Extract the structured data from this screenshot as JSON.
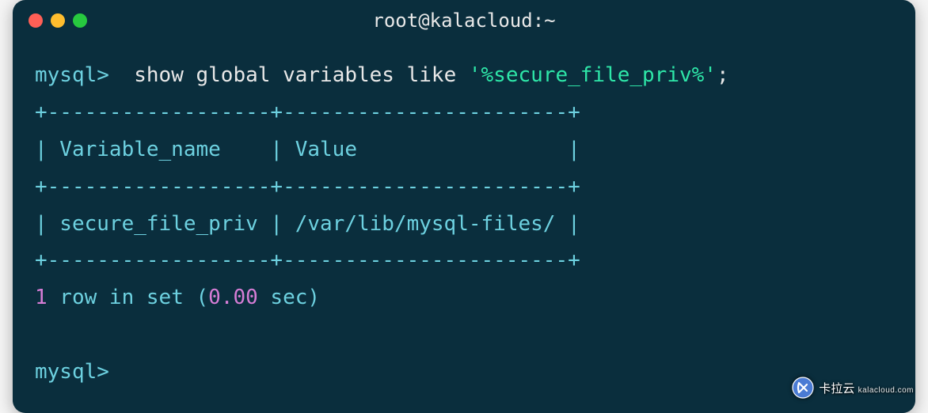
{
  "window": {
    "title": "root@kalacloud:~"
  },
  "terminal": {
    "prompt": "mysql>",
    "command_prefix": "show global variables like ",
    "command_arg": "'%secure_file_priv%'",
    "command_semicolon": ";",
    "table": {
      "border_top": "+------------------+-----------------------+",
      "header_row": "| Variable_name    | Value                 |",
      "border_mid": "+------------------+-----------------------+",
      "data_row": "| secure_file_priv | /var/lib/mysql-files/ |",
      "border_bottom": "+------------------+-----------------------+",
      "headers": [
        "Variable_name",
        "Value"
      ],
      "rows": [
        {
          "Variable_name": "secure_file_priv",
          "Value": "/var/lib/mysql-files/"
        }
      ]
    },
    "status": {
      "count": "1",
      "mid": " row in set (",
      "time": "0.00",
      "tail": " sec)"
    },
    "prompt2": "mysql>"
  },
  "watermark": {
    "brand": "卡拉云",
    "domain": "kalacloud.com"
  }
}
